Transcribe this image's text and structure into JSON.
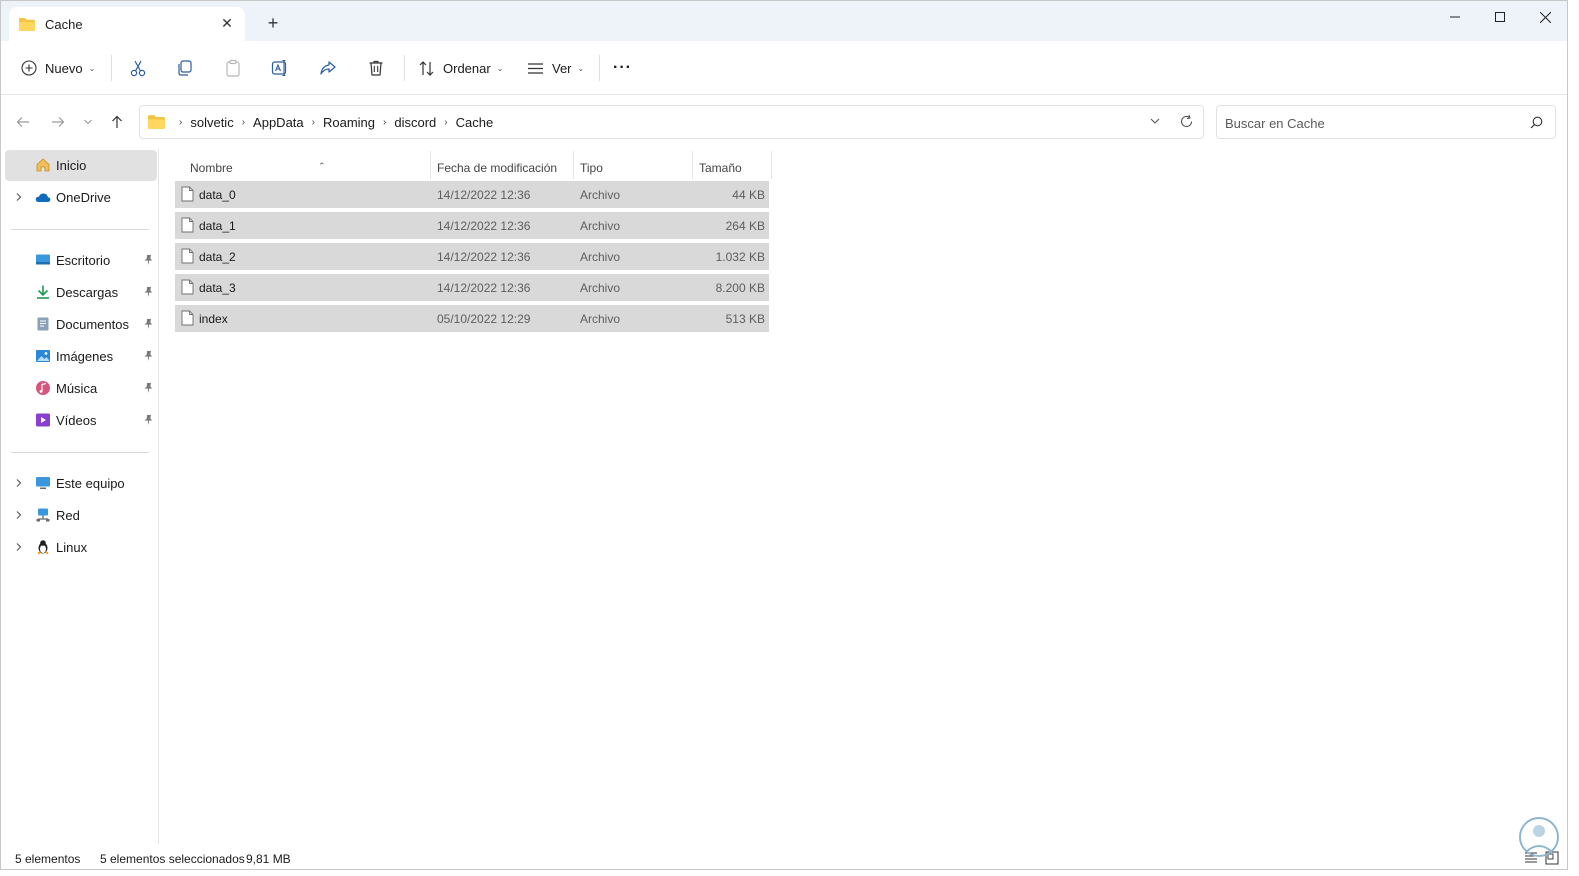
{
  "window": {
    "tab_title": "Cache",
    "add_tab_symbol": "+",
    "close_tab_symbol": "✕"
  },
  "toolbar": {
    "new_label": "Nuevo",
    "sort_label": "Ordenar",
    "view_label": "Ver",
    "more_label": "···"
  },
  "address": {
    "crumbs": [
      "solvetic",
      "AppData",
      "Roaming",
      "discord",
      "Cache"
    ],
    "separator": "›"
  },
  "search": {
    "placeholder": "Buscar en Cache"
  },
  "sidebar": {
    "home": "Inicio",
    "onedrive": "OneDrive",
    "quick": [
      {
        "label": "Escritorio",
        "icon": "desktop-icon"
      },
      {
        "label": "Descargas",
        "icon": "download-icon"
      },
      {
        "label": "Documentos",
        "icon": "documents-icon"
      },
      {
        "label": "Imágenes",
        "icon": "pictures-icon"
      },
      {
        "label": "Música",
        "icon": "music-icon"
      },
      {
        "label": "Vídeos",
        "icon": "videos-icon"
      }
    ],
    "this_pc": "Este equipo",
    "network": "Red",
    "linux": "Linux"
  },
  "columns": {
    "name": "Nombre",
    "modified": "Fecha de modificación",
    "type": "Tipo",
    "size": "Tamaño"
  },
  "files": [
    {
      "name": "data_0",
      "modified": "14/12/2022 12:36",
      "type": "Archivo",
      "size": "44 KB"
    },
    {
      "name": "data_1",
      "modified": "14/12/2022 12:36",
      "type": "Archivo",
      "size": "264 KB"
    },
    {
      "name": "data_2",
      "modified": "14/12/2022 12:36",
      "type": "Archivo",
      "size": "1.032 KB"
    },
    {
      "name": "data_3",
      "modified": "14/12/2022 12:36",
      "type": "Archivo",
      "size": "8.200 KB"
    },
    {
      "name": "index",
      "modified": "05/10/2022 12:29",
      "type": "Archivo",
      "size": "513 KB"
    }
  ],
  "status": {
    "count": "5 elementos",
    "selected": "5 elementos seleccionados",
    "size": "9,81 MB"
  },
  "colors": {
    "accent": "#005fb8",
    "folder": "#f4c542",
    "selection": "#d9d9d9",
    "titlebar": "#eef3f9"
  }
}
